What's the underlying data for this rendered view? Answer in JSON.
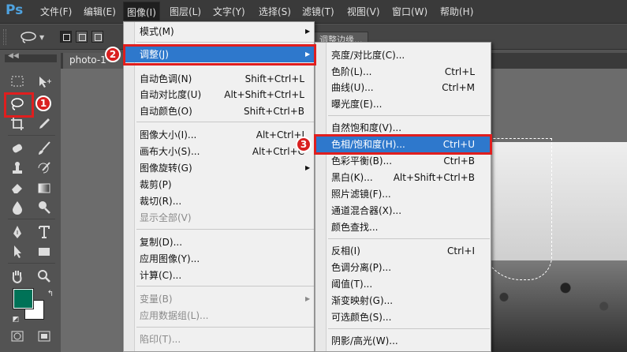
{
  "app": {
    "logo": "Ps"
  },
  "menubar": [
    {
      "label": "文件(F)"
    },
    {
      "label": "编辑(E)"
    },
    {
      "label": "图像(I)"
    },
    {
      "label": "图层(L)"
    },
    {
      "label": "文字(Y)"
    },
    {
      "label": "选择(S)"
    },
    {
      "label": "滤镜(T)"
    },
    {
      "label": "视图(V)"
    },
    {
      "label": "窗口(W)"
    },
    {
      "label": "帮助(H)"
    }
  ],
  "options_bar": {
    "refine_edge": "调整边缘..."
  },
  "document": {
    "tab_label": "photo-1"
  },
  "colors": {
    "foreground": "#007257",
    "background": "#ffffff",
    "highlight": "#2e78cc",
    "annotation": "#e01e1e"
  },
  "image_menu": [
    {
      "label": "模式(M)",
      "shortcut": "",
      "submenu": true
    },
    {
      "label": "调整(J)",
      "shortcut": "",
      "submenu": true,
      "highlighted": true
    },
    {
      "label": "自动色调(N)",
      "shortcut": "Shift+Ctrl+L"
    },
    {
      "label": "自动对比度(U)",
      "shortcut": "Alt+Shift+Ctrl+L"
    },
    {
      "label": "自动颜色(O)",
      "shortcut": "Shift+Ctrl+B"
    },
    {
      "label": "图像大小(I)...",
      "shortcut": "Alt+Ctrl+I"
    },
    {
      "label": "画布大小(S)...",
      "shortcut": "Alt+Ctrl+C"
    },
    {
      "label": "图像旋转(G)",
      "shortcut": "",
      "submenu": true
    },
    {
      "label": "裁剪(P)",
      "shortcut": ""
    },
    {
      "label": "裁切(R)...",
      "shortcut": ""
    },
    {
      "label": "显示全部(V)",
      "shortcut": "",
      "disabled": true
    },
    {
      "label": "复制(D)...",
      "shortcut": ""
    },
    {
      "label": "应用图像(Y)...",
      "shortcut": ""
    },
    {
      "label": "计算(C)...",
      "shortcut": ""
    },
    {
      "label": "变量(B)",
      "shortcut": "",
      "submenu": true,
      "disabled": true
    },
    {
      "label": "应用数据组(L)...",
      "shortcut": "",
      "disabled": true
    },
    {
      "label": "陷印(T)...",
      "shortcut": "",
      "disabled": true
    }
  ],
  "adjust_menu": [
    {
      "label": "亮度/对比度(C)...",
      "shortcut": ""
    },
    {
      "label": "色阶(L)...",
      "shortcut": "Ctrl+L"
    },
    {
      "label": "曲线(U)...",
      "shortcut": "Ctrl+M"
    },
    {
      "label": "曝光度(E)...",
      "shortcut": ""
    },
    {
      "label": "自然饱和度(V)...",
      "shortcut": ""
    },
    {
      "label": "色相/饱和度(H)...",
      "shortcut": "Ctrl+U",
      "highlighted": true
    },
    {
      "label": "色彩平衡(B)...",
      "shortcut": "Ctrl+B"
    },
    {
      "label": "黑白(K)...",
      "shortcut": "Alt+Shift+Ctrl+B"
    },
    {
      "label": "照片滤镜(F)...",
      "shortcut": ""
    },
    {
      "label": "通道混合器(X)...",
      "shortcut": ""
    },
    {
      "label": "颜色查找...",
      "shortcut": ""
    },
    {
      "label": "反相(I)",
      "shortcut": "Ctrl+I"
    },
    {
      "label": "色调分离(P)...",
      "shortcut": ""
    },
    {
      "label": "阈值(T)...",
      "shortcut": ""
    },
    {
      "label": "渐变映射(G)...",
      "shortcut": ""
    },
    {
      "label": "可选颜色(S)...",
      "shortcut": ""
    },
    {
      "label": "阴影/高光(W)...",
      "shortcut": ""
    }
  ],
  "step_badges": [
    "1",
    "2",
    "3"
  ]
}
